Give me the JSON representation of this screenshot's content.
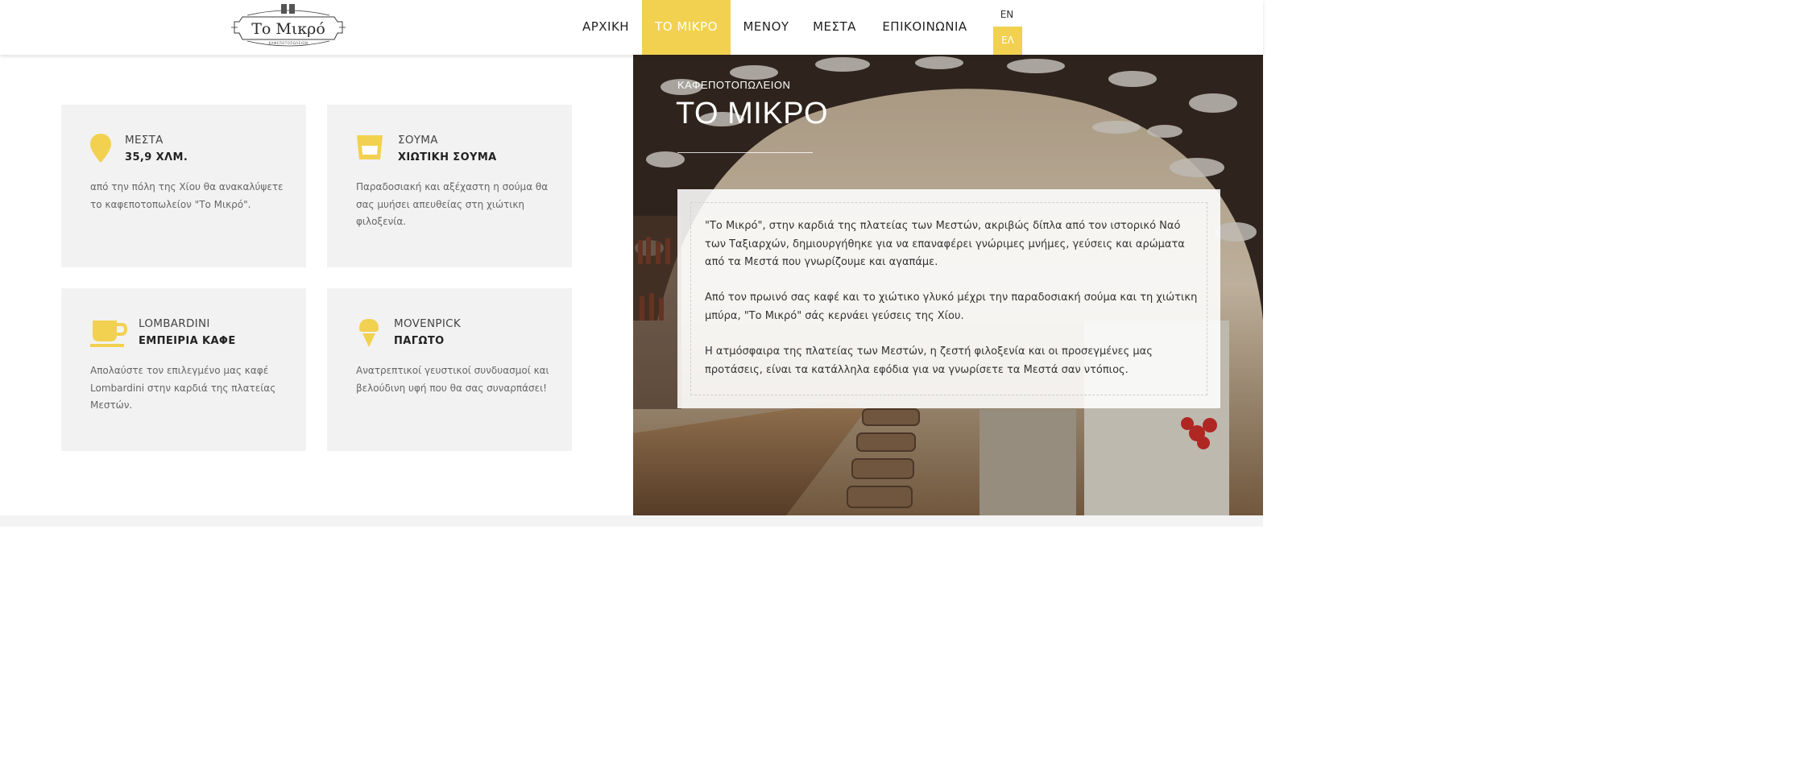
{
  "logo": {
    "text": "Το Μικρό",
    "tagline": "ΚΑΦΕΠΟΤΟΠΩΛΕΙΟΝ"
  },
  "nav": {
    "items": [
      {
        "label": "ΑΡΧΙΚΗ",
        "active": false
      },
      {
        "label": "ΤΟ ΜΙΚΡΟ",
        "active": true
      },
      {
        "label": "ΜΕΝΟΥ",
        "active": false
      },
      {
        "label": "ΜΕΣΤΑ",
        "active": false
      },
      {
        "label": "ΕΠΙΚΟΙΝΩΝΙΑ",
        "active": false
      }
    ],
    "languages": [
      {
        "label": "EN",
        "active": false
      },
      {
        "label": "ΕΛ",
        "active": true
      }
    ]
  },
  "features": [
    {
      "icon": "location-pin-icon",
      "caption": "ΜΕΣΤΑ",
      "subtitle": "35,9 ΧΛΜ.",
      "description": "από την πόλη της Χίου θα ανακαλύψετε το καφεποτοπωλείον \"Το Μικρό\"."
    },
    {
      "icon": "glass-icon",
      "caption": "ΣΟΥΜΑ",
      "subtitle": "ΧΙΩΤΙΚΗ ΣΟΥΜΑ",
      "description": "Παραδοσιακή και αξέχαστη η σούμα θα σας μυήσει απευθείας στη χιώτικη φιλοξενία."
    },
    {
      "icon": "coffee-cup-icon",
      "caption": "LOMBARDINI",
      "subtitle": "ΕΜΠΕΙΡΙΑ ΚΑΦΕ",
      "description": "Απολαύστε τον επιλεγμένο μας καφέ Lombardini στην καρδιά της πλατείας Μεστών."
    },
    {
      "icon": "ice-cream-icon",
      "caption": "MOVENPICK",
      "subtitle": "ΠΑΓΩΤΟ",
      "description": "Ανατρεπτικοί γευστικοί συνδυασμοί και βελούδινη υφή που θα σας συναρπάσει!"
    }
  ],
  "hero": {
    "kicker": "ΚΑΦΕΠΟΤΟΠΩΛΕΙΟΝ",
    "title": "ΤΟ ΜΙΚΡΟ",
    "paragraphs": [
      "\"Το Μικρό\", στην καρδιά της πλατείας των Μεστών, ακριβώς δίπλα από τον ιστορικό Ναό των Ταξιαρχών, δημιουργήθηκε για να επαναφέρει γνώριμες μνήμες, γεύσεις και αρώματα από τα Μεστά που γνωρίζουμε και αγαπάμε.",
      "Από τον πρωινό σας καφέ και το χιώτικο γλυκό μέχρι την παραδοσιακή σούμα και τη χιώτικη μπύρα, \"Το Μικρό\" σάς κερνάει γεύσεις της Χίου.",
      "Η ατμόσφαιρα της πλατείας των Μεστών, η ζεστή φιλοξενία και οι προσεγμένες μας προτάσεις, είναι τα κατάλληλα εφόδια για να γνωρίσετε τα Μεστά σαν ντόπιος."
    ]
  },
  "colors": {
    "accent": "#f2d150",
    "card_bg": "#f2f2f2",
    "text": "#333333"
  }
}
